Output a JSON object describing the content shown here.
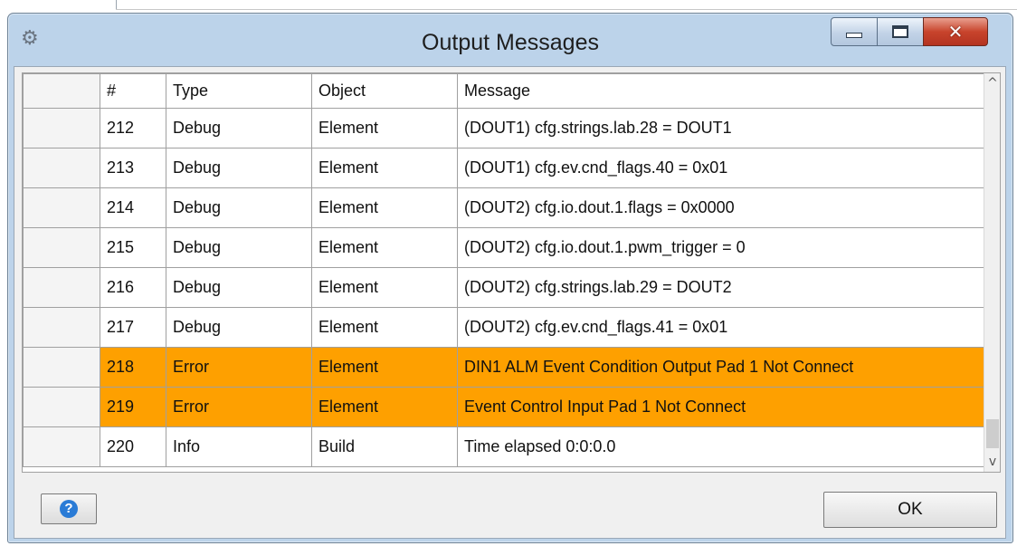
{
  "window": {
    "title": "Output Messages"
  },
  "table": {
    "headers": {
      "num": "#",
      "type": "Type",
      "object": "Object",
      "message": "Message"
    },
    "rows": [
      {
        "num": "212",
        "type": "Debug",
        "object": "Element",
        "message": "(DOUT1) cfg.strings.lab.28 = DOUT1",
        "status": "normal"
      },
      {
        "num": "213",
        "type": "Debug",
        "object": "Element",
        "message": "(DOUT1) cfg.ev.cnd_flags.40 = 0x01",
        "status": "normal"
      },
      {
        "num": "214",
        "type": "Debug",
        "object": "Element",
        "message": "(DOUT2) cfg.io.dout.1.flags = 0x0000",
        "status": "normal"
      },
      {
        "num": "215",
        "type": "Debug",
        "object": "Element",
        "message": "(DOUT2) cfg.io.dout.1.pwm_trigger = 0",
        "status": "normal"
      },
      {
        "num": "216",
        "type": "Debug",
        "object": "Element",
        "message": "(DOUT2) cfg.strings.lab.29 = DOUT2",
        "status": "normal"
      },
      {
        "num": "217",
        "type": "Debug",
        "object": "Element",
        "message": "(DOUT2) cfg.ev.cnd_flags.41 = 0x01",
        "status": "normal"
      },
      {
        "num": "218",
        "type": "Error",
        "object": "Element",
        "message": "DIN1 ALM Event Condition Output Pad 1 Not Connect",
        "status": "error"
      },
      {
        "num": "219",
        "type": "Error",
        "object": "Element",
        "message": "Event Control Input Pad 1 Not Connect",
        "status": "error"
      },
      {
        "num": "220",
        "type": "Info",
        "object": "Build",
        "message": "Time elapsed 0:0:0.0",
        "status": "normal"
      }
    ]
  },
  "buttons": {
    "ok_label": "OK"
  },
  "colors": {
    "error_row": "#fea000",
    "title_bar": "#bcd3ea",
    "close_button": "#c8442c"
  },
  "icons": {
    "app": "gears-icon",
    "help": "help-icon",
    "minimize": "minimize-icon",
    "maximize": "maximize-icon",
    "close": "close-icon"
  }
}
